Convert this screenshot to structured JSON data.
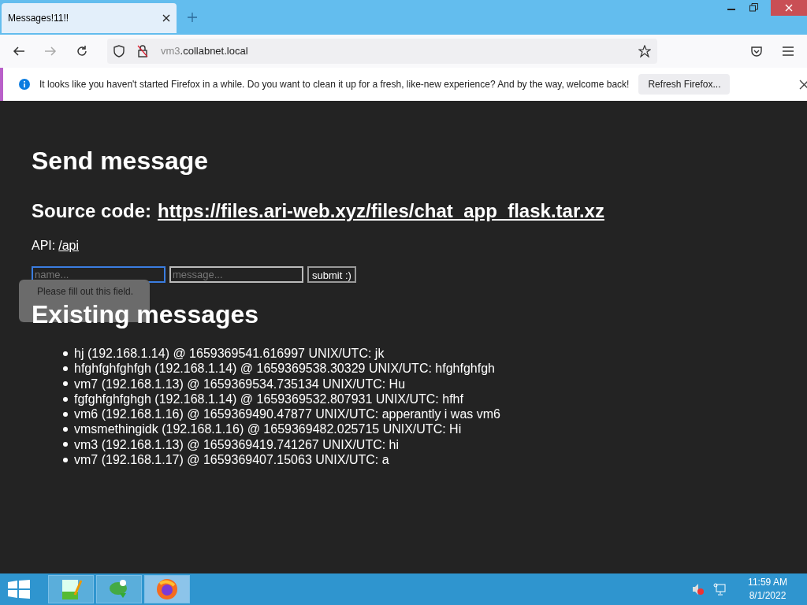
{
  "tabs": [
    {
      "title": "Messages!11!!",
      "selected": true
    }
  ],
  "address": {
    "host_prefix": "vm3",
    "host_rest": ".collabnet.local"
  },
  "notification": {
    "text": "It looks like you haven't started Firefox in a while. Do you want to clean it up for a fresh, like-new experience? And by the way, welcome back!",
    "button": "Refresh Firefox..."
  },
  "page": {
    "heading": "Send message",
    "source_label": "Source code:",
    "source_link": "https://files.ari-web.xyz/files/chat_app_flask.tar.xz",
    "api_label": "API:",
    "api_link": "/api",
    "form": {
      "name_placeholder": "name...",
      "message_placeholder": "message...",
      "submit": "submit :)",
      "validation_tooltip": "Please fill out this field."
    },
    "messages_heading": "Existing messages",
    "messages": [
      "hj (192.168.1.14) @ 1659369541.616997 UNIX/UTC: jk",
      "hfghfghfghfgh (192.168.1.14) @ 1659369538.30329 UNIX/UTC: hfghfghfgh",
      "vm7 (192.168.1.13) @ 1659369534.735134 UNIX/UTC: Hu",
      "fgfghfghfghgh (192.168.1.14) @ 1659369532.807931 UNIX/UTC: hfhf",
      "vm6 (192.168.1.16) @ 1659369490.47877 UNIX/UTC: apperantly i was vm6",
      "vmsmethingidk (192.168.1.16) @ 1659369482.025715 UNIX/UTC: Hi",
      "vm3 (192.168.1.13) @ 1659369419.741267 UNIX/UTC: hi",
      "vm7 (192.168.1.17) @ 1659369407.15063 UNIX/UTC: a"
    ]
  },
  "taskbar": {
    "apps": [
      {
        "kind": "notepad",
        "selected": false
      },
      {
        "kind": "editor",
        "selected": false
      },
      {
        "kind": "firefox",
        "selected": true
      }
    ],
    "time": "11:59 AM",
    "date": "8/1/2022"
  }
}
